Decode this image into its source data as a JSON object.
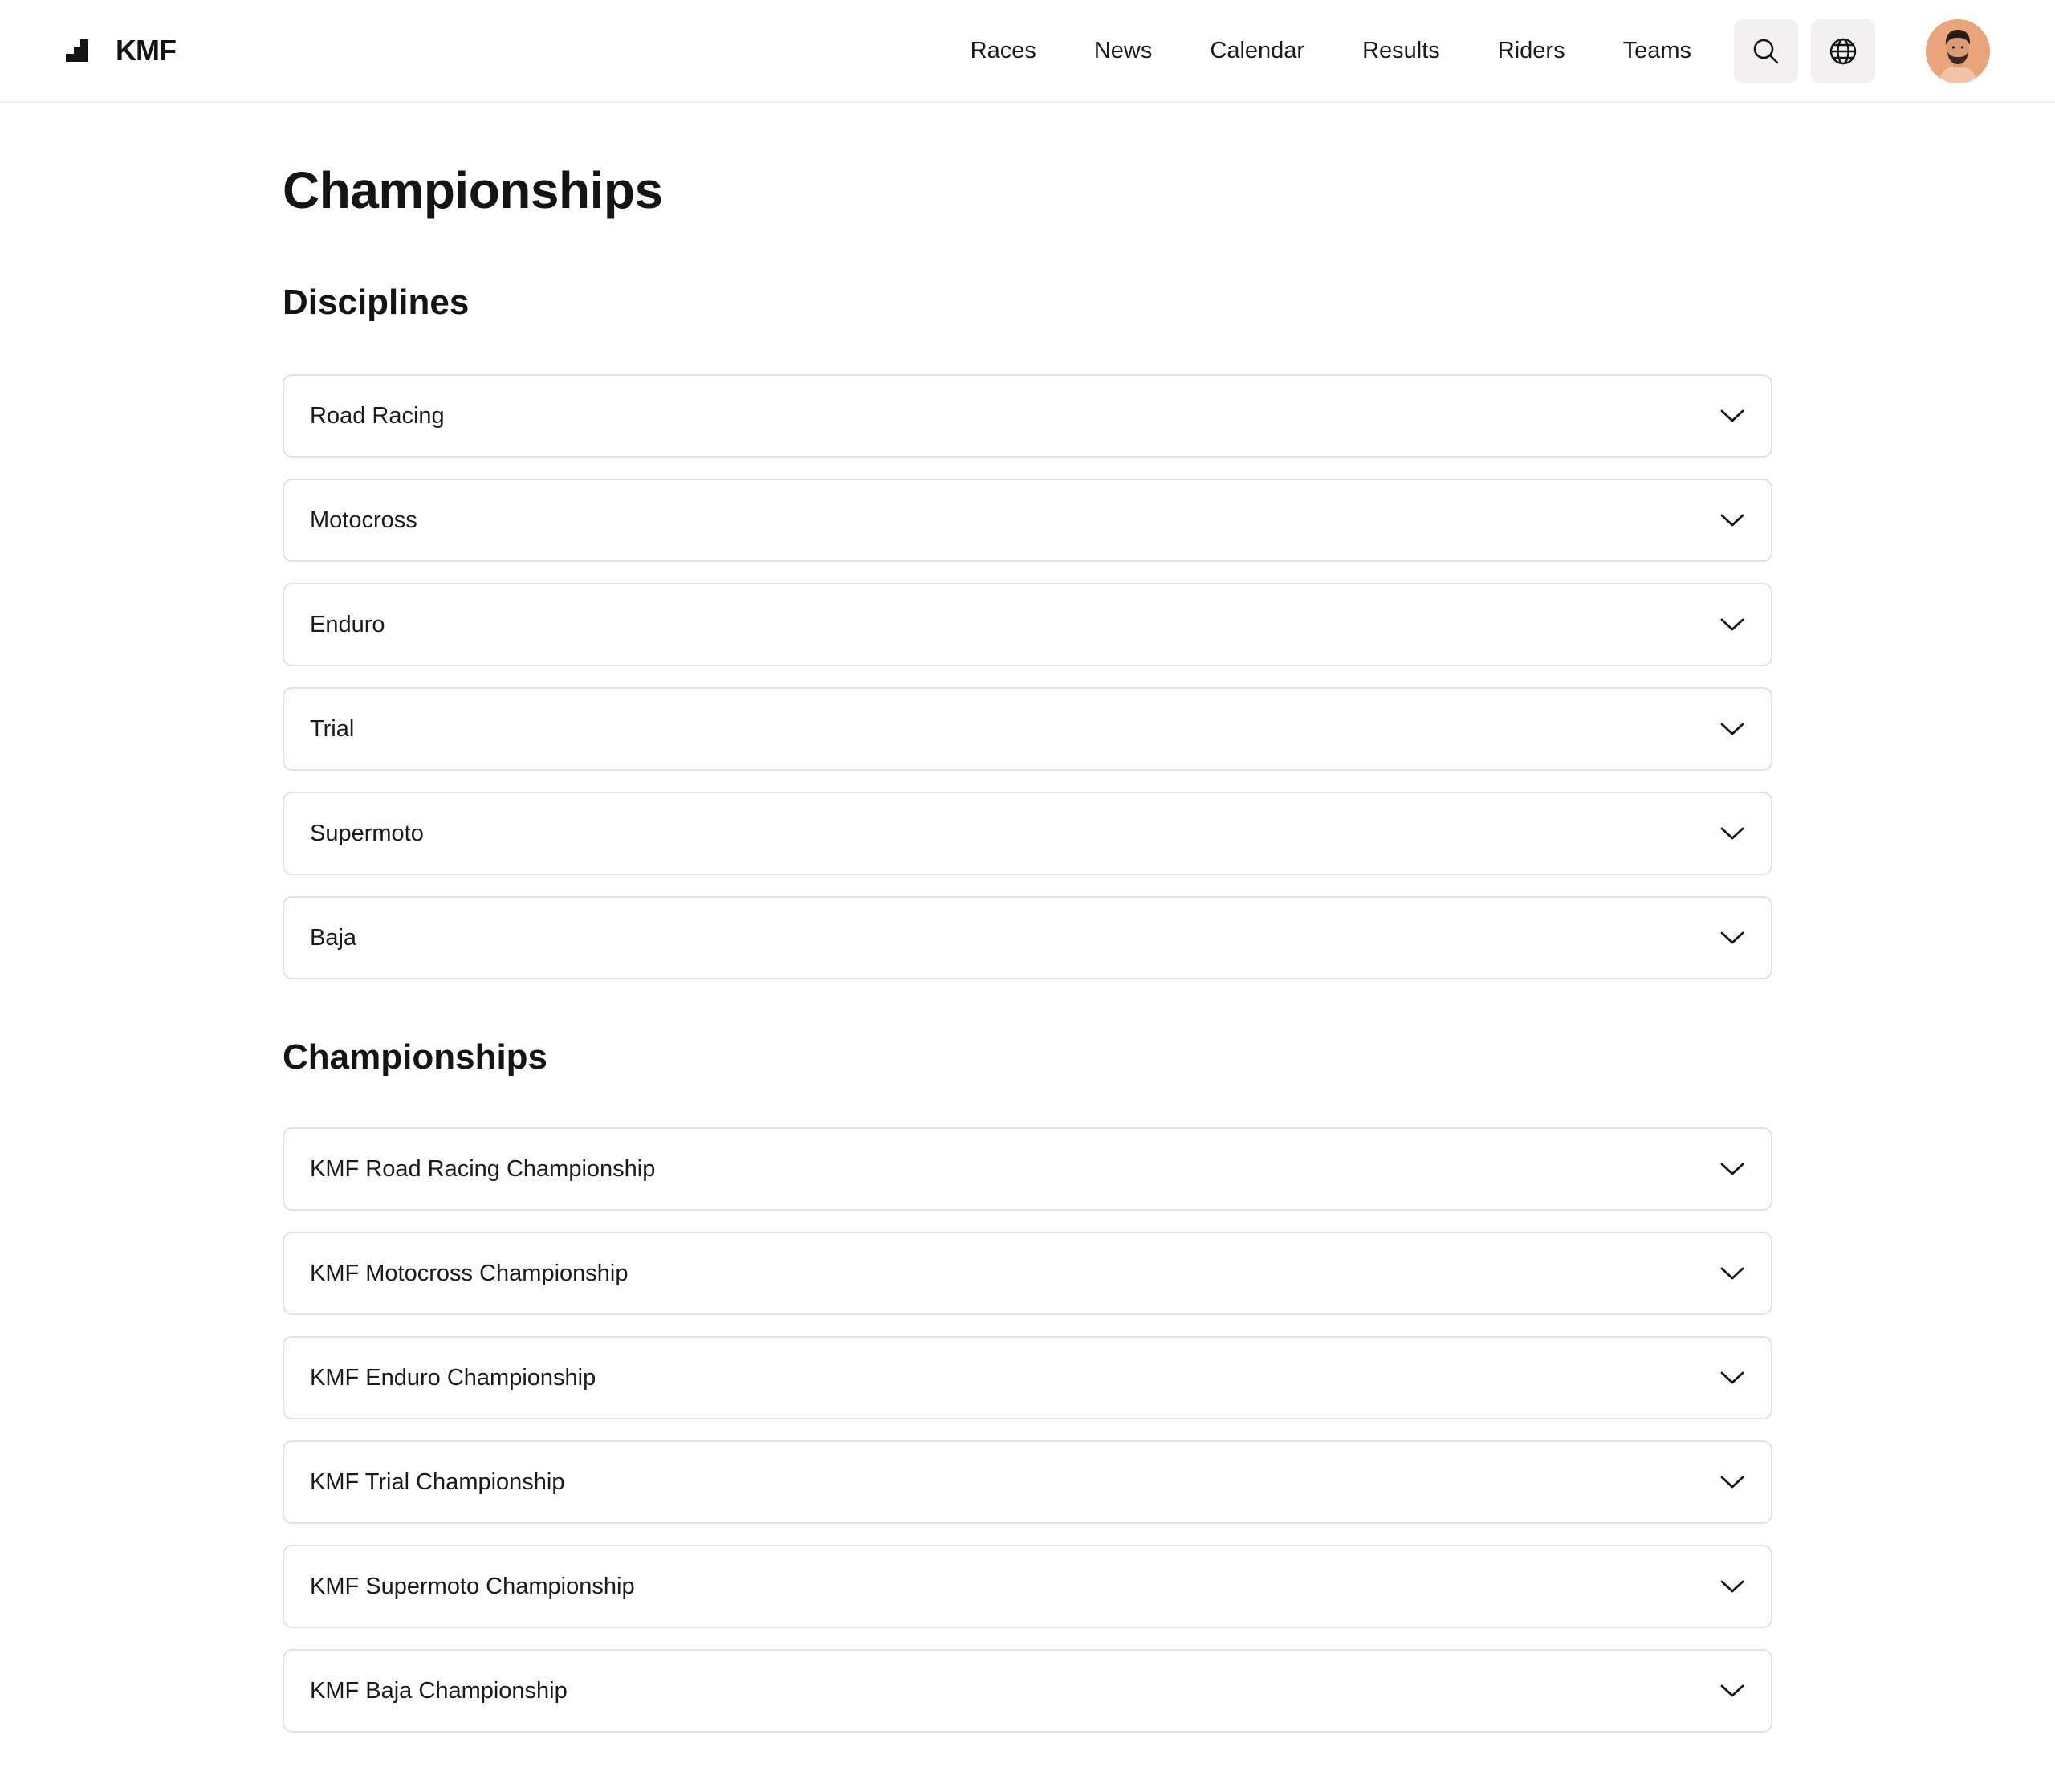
{
  "brand": {
    "name": "KMF"
  },
  "nav": {
    "items": [
      {
        "label": "Races"
      },
      {
        "label": "News"
      },
      {
        "label": "Calendar"
      },
      {
        "label": "Results"
      },
      {
        "label": "Riders"
      },
      {
        "label": "Teams"
      }
    ],
    "icons": [
      "search-icon",
      "globe-icon"
    ]
  },
  "page": {
    "title": "Championships"
  },
  "disciplines": {
    "title": "Disciplines",
    "items": [
      {
        "label": "Road Racing"
      },
      {
        "label": "Motocross"
      },
      {
        "label": "Enduro"
      },
      {
        "label": "Trial"
      },
      {
        "label": "Supermoto"
      },
      {
        "label": "Baja"
      }
    ]
  },
  "championships": {
    "title": "Championships",
    "items": [
      {
        "label": "KMF Road Racing Championship"
      },
      {
        "label": "KMF Motocross Championship"
      },
      {
        "label": "KMF Enduro Championship"
      },
      {
        "label": "KMF Trial Championship"
      },
      {
        "label": "KMF Supermoto Championship"
      },
      {
        "label": "KMF Baja Championship"
      }
    ]
  },
  "colors": {
    "text": "#141414",
    "border": "#e4e2e2",
    "icon_button_bg": "#f2f0f0",
    "avatar_bg": "#e9a579"
  }
}
